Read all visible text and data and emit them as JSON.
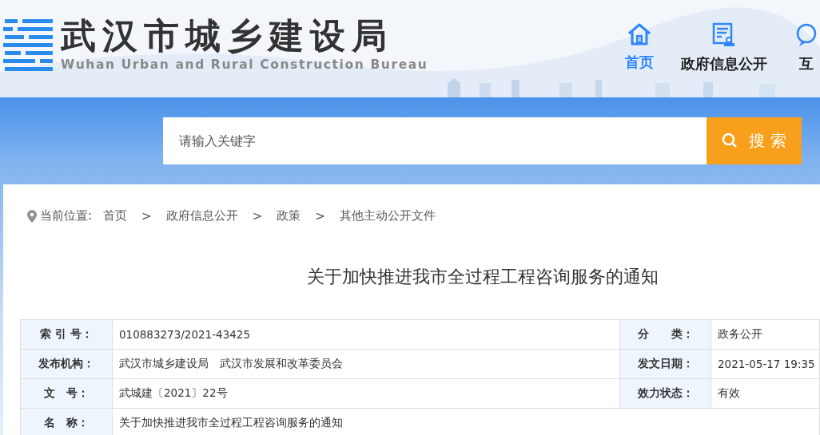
{
  "header": {
    "title": "武汉市城乡建设局",
    "subtitle": "Wuhan Urban and Rural Construction Bureau"
  },
  "nav": [
    {
      "label": "首页",
      "kind": "home",
      "selected": true
    },
    {
      "label": "政府信息公开",
      "kind": "document",
      "selected": false
    },
    {
      "label": "互",
      "kind": "chat",
      "selected": false
    }
  ],
  "search": {
    "placeholder": "请输入关键字",
    "button": "搜 索"
  },
  "breadcrumb": {
    "label": "当前位置:",
    "separator": ">",
    "items": [
      "首页",
      "政府信息公开",
      "政策",
      "其他主动公开文件"
    ]
  },
  "article_title": "关于加快推进我市全过程工程咨询服务的通知",
  "info_table": [
    {
      "cells": [
        {
          "kind": "label",
          "text": "索 引 号："
        },
        {
          "kind": "value",
          "text": "010883273/2021-43425"
        },
        {
          "kind": "label",
          "text": "分　　类："
        },
        {
          "kind": "value",
          "text": "政务公开"
        }
      ]
    },
    {
      "cells": [
        {
          "kind": "label",
          "text": "发布机构："
        },
        {
          "kind": "value",
          "text": "武汉市城乡建设局　武汉市发展和改革委员会"
        },
        {
          "kind": "label",
          "text": "发文日期："
        },
        {
          "kind": "value",
          "text": "2021-05-17 19:35"
        }
      ]
    },
    {
      "cells": [
        {
          "kind": "label",
          "text": "文　号："
        },
        {
          "kind": "value",
          "text": "武城建〔2021〕22号"
        },
        {
          "kind": "label",
          "text": "效力状态："
        },
        {
          "kind": "value",
          "text": "有效"
        }
      ]
    },
    {
      "cells": [
        {
          "kind": "label",
          "text": "名　称："
        },
        {
          "kind": "wide",
          "text": "关于加快推进我市全过程工程咨询服务的通知"
        }
      ]
    }
  ]
}
